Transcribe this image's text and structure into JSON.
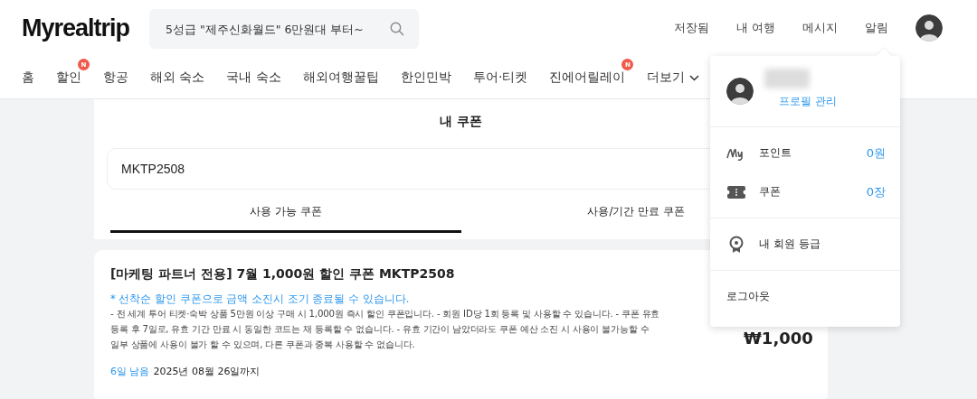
{
  "header": {
    "logo": "Myrealtrip",
    "search": {
      "placeholder": "5성급 \"제주신화월드\" 6만원대 부터~"
    },
    "links": [
      "저장됨",
      "내 여행",
      "메시지",
      "알림"
    ]
  },
  "nav": [
    {
      "label": "홈"
    },
    {
      "label": "할인",
      "badge": "N"
    },
    {
      "label": "항공"
    },
    {
      "label": "해외 숙소"
    },
    {
      "label": "국내 숙소"
    },
    {
      "label": "해외여행꿀팁"
    },
    {
      "label": "한인민박"
    },
    {
      "label": "투어·티켓"
    },
    {
      "label": "진에어릴레이",
      "badge": "N"
    },
    {
      "label": "더보기",
      "kind": "dropdown"
    }
  ],
  "page": {
    "title": "내 쿠폰",
    "code_field": {
      "value": "MKTP2508"
    },
    "tabs": [
      {
        "label": "사용 가능 쿠폰",
        "selected": true
      },
      {
        "label": "사용/기간 만료 쿠폰",
        "selected": false
      }
    ]
  },
  "coupon": {
    "title": "[마케팅 파트너 전용] 7월 1,000원 할인 쿠폰 MKTP2508",
    "notice": "* 선착순 할인 쿠폰으로 금액 소진시 조기 종료될 수 있습니다.",
    "description_lines": [
      "- 전 세계 투어 티켓·숙박 상품 5만원 이상 구매 시 1,000원 즉시 할인 쿠폰입니다. - 회원 ID당 1회 등록 및 사용할 수 있습니다. - 쿠폰 유효",
      "등록 후 7일로, 유효 기간 만료 시 동일한 코드는 재 등록할 수 없습니다. - 유효 기간이 남았더라도 쿠폰 예산 소진 시 사용이 불가능할 수",
      "일부 상품에 사용이 불가 할 수 있으며, 다른 쿠폰과 중복 사용할 수 없습니다."
    ],
    "amount": "₩1,000",
    "remaining": "6일 남음",
    "expiry": "2025년 08월 26일까지"
  },
  "menu": {
    "profile_link": "프로필 관리",
    "items": [
      {
        "kind": "points",
        "label": "포인트",
        "value": "0원"
      },
      {
        "kind": "coupons",
        "label": "쿠폰",
        "value": "0장"
      },
      {
        "kind": "grade",
        "label": "내 회원 등급"
      },
      {
        "kind": "logout",
        "label": "로그아웃"
      }
    ]
  }
}
